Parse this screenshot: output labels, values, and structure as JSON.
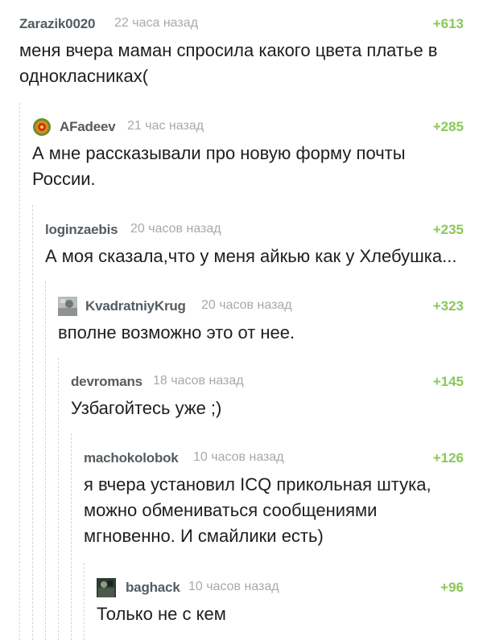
{
  "comments": [
    {
      "author": "Zarazik0020",
      "time": "22 часа назад",
      "rating": "+613",
      "text": "меня вчера маман спросила какого цвета платье в\nоднокласниках(",
      "avatar": "none"
    },
    {
      "author": "AFadeev",
      "time": "21 час назад",
      "rating": "+285",
      "text": "А мне рассказывали про новую форму почты\nРоссии.",
      "avatar": "orange-swirl-avatar"
    },
    {
      "author": "loginzaebis",
      "time": "20 часов назад",
      "rating": "+235",
      "text": "А моя сказала,что у меня айкью как у Хлебушка...",
      "avatar": "none"
    },
    {
      "author": "KvadratniyKrug",
      "time": "20 часов назад",
      "rating": "+323",
      "text": "вполне возможно это от нее.",
      "avatar": "grey-photo-avatar"
    },
    {
      "author": "devromans",
      "time": "18 часов назад",
      "rating": "+145",
      "text": "Узбагойтесь уже ;)",
      "avatar": "none"
    },
    {
      "author": "machokolobok",
      "time": "10 часов назад",
      "rating": "+126",
      "text": "я вчера установил ICQ прикольная штука,\nможно обмениваться сообщениями\nмгновенно. И смайлики есть)",
      "avatar": "none"
    },
    {
      "author": "baghack",
      "time": "10 часов назад",
      "rating": "+96",
      "text": "Только не с кем",
      "avatar": "dark-photo-avatar"
    }
  ],
  "colors": {
    "author": "#555c61",
    "time": "#a6aaad",
    "rating": "#8ac858",
    "text": "#1e1e1e",
    "thread_line": "#d4d4d4"
  }
}
